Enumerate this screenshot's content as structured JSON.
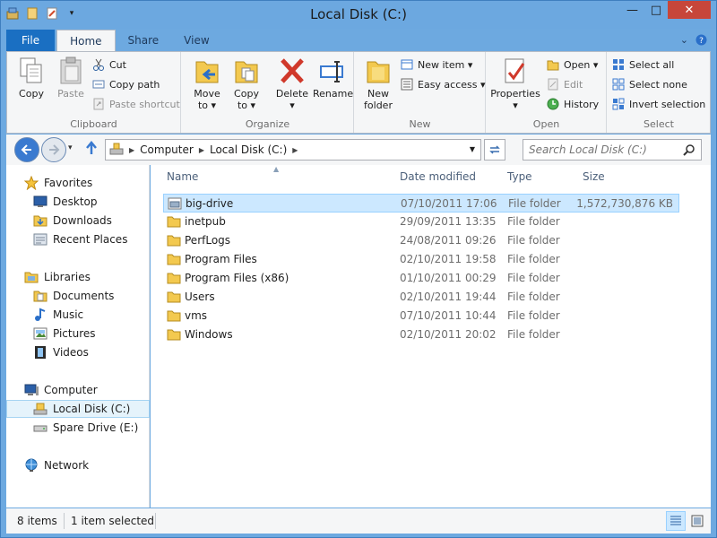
{
  "window": {
    "title": "Local Disk (C:)",
    "minimize": "—",
    "maximize": "□",
    "close": "✕"
  },
  "ribbon_tabs": [
    "File",
    "Home",
    "Share",
    "View"
  ],
  "ribbon": {
    "clipboard": {
      "label": "Clipboard",
      "copy": "Copy",
      "paste": "Paste",
      "cut": "Cut",
      "copy_path": "Copy path",
      "paste_shortcut": "Paste shortcut"
    },
    "organize": {
      "label": "Organize",
      "move_to_1": "Move",
      "move_to_2": "to ▾",
      "copy_to_1": "Copy",
      "copy_to_2": "to ▾",
      "delete_1": "Delete",
      "delete_2": "▾",
      "rename": "Rename"
    },
    "new": {
      "label": "New",
      "new_folder_1": "New",
      "new_folder_2": "folder",
      "new_item": "New item ▾",
      "easy_access": "Easy access ▾"
    },
    "open": {
      "label": "Open",
      "properties_1": "Properties",
      "properties_2": "▾",
      "open": "Open ▾",
      "edit": "Edit",
      "history": "History"
    },
    "select": {
      "label": "Select",
      "select_all": "Select all",
      "select_none": "Select none",
      "invert_selection": "Invert selection"
    }
  },
  "address": {
    "segments": [
      "Computer",
      "Local Disk (C:)"
    ],
    "search_placeholder": "Search Local Disk (C:)"
  },
  "nav_pane": {
    "favorites": "Favorites",
    "desktop": "Desktop",
    "downloads": "Downloads",
    "recent_places": "Recent Places",
    "libraries": "Libraries",
    "documents": "Documents",
    "music": "Music",
    "pictures": "Pictures",
    "videos": "Videos",
    "computer": "Computer",
    "local_disk": "Local Disk (C:)",
    "spare_drive": "Spare Drive (E:)",
    "network": "Network"
  },
  "columns": {
    "name": "Name",
    "date_modified": "Date modified",
    "type": "Type",
    "size": "Size"
  },
  "files": [
    {
      "name": "big-drive",
      "date": "07/10/2011 17:06",
      "type": "File folder",
      "size": "1,572,730,876 KB"
    },
    {
      "name": "inetpub",
      "date": "29/09/2011 13:35",
      "type": "File folder",
      "size": ""
    },
    {
      "name": "PerfLogs",
      "date": "24/08/2011 09:26",
      "type": "File folder",
      "size": ""
    },
    {
      "name": "Program Files",
      "date": "02/10/2011 19:58",
      "type": "File folder",
      "size": ""
    },
    {
      "name": "Program Files (x86)",
      "date": "01/10/2011 00:29",
      "type": "File folder",
      "size": ""
    },
    {
      "name": "Users",
      "date": "02/10/2011 19:44",
      "type": "File folder",
      "size": ""
    },
    {
      "name": "vms",
      "date": "07/10/2011 10:44",
      "type": "File folder",
      "size": ""
    },
    {
      "name": "Windows",
      "date": "02/10/2011 20:02",
      "type": "File folder",
      "size": ""
    }
  ],
  "status": {
    "items": "8 items",
    "selected": "1 item selected"
  }
}
